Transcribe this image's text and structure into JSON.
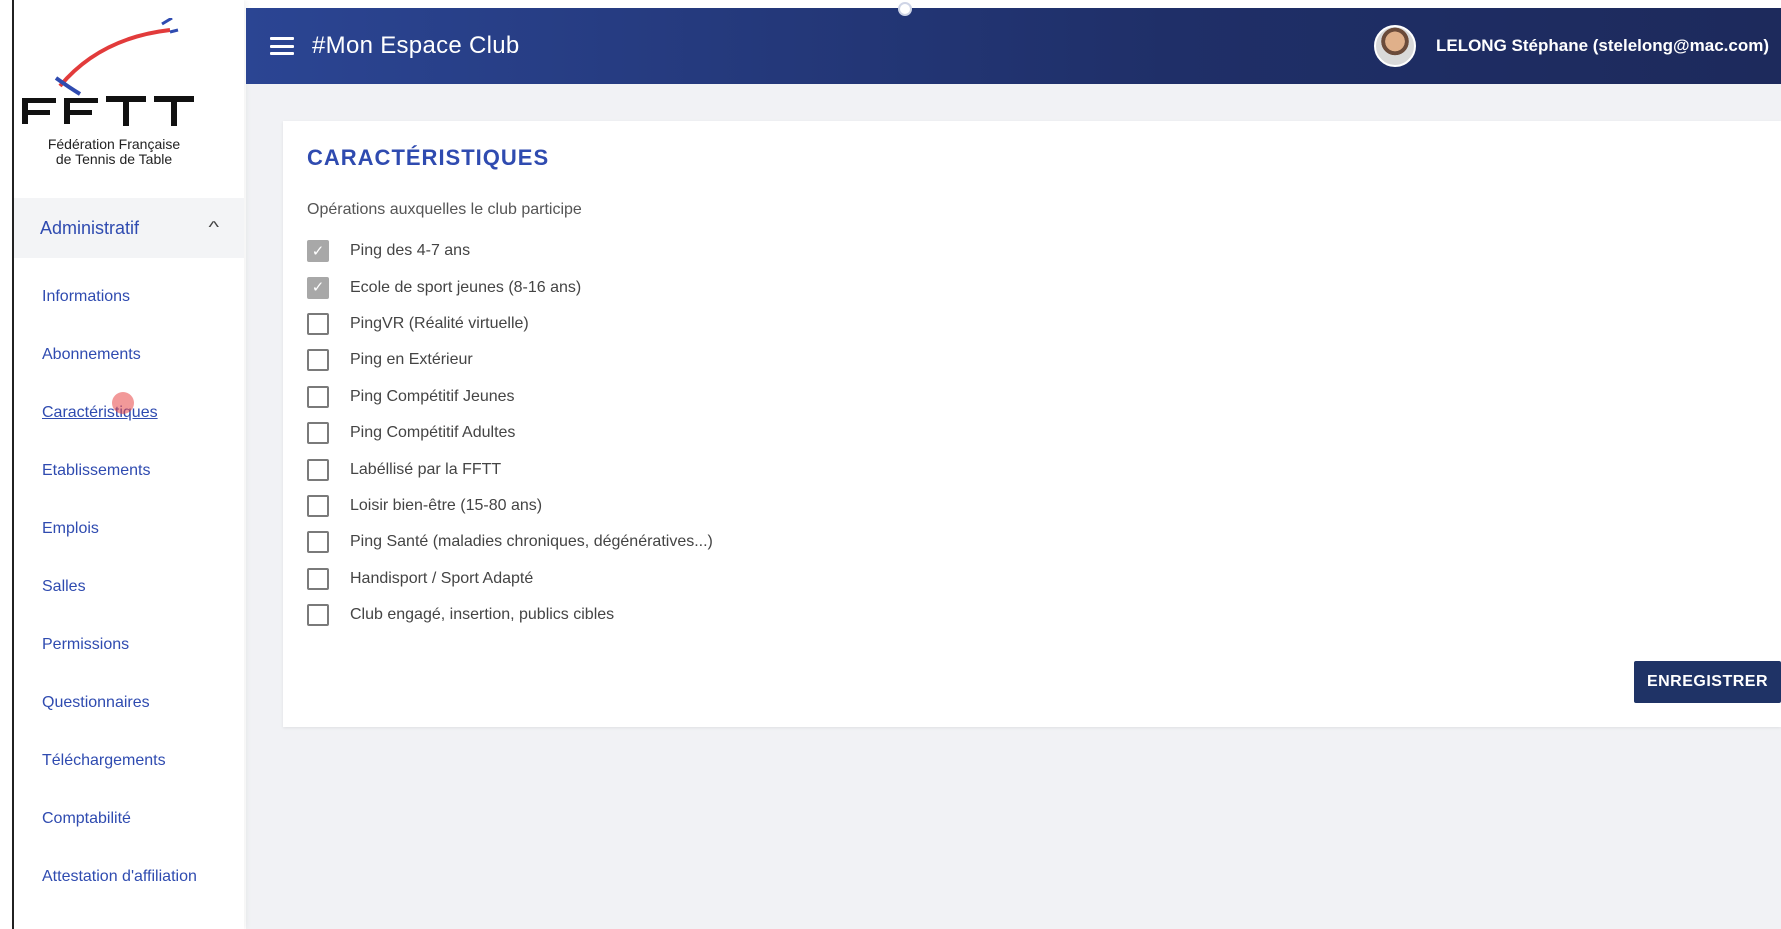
{
  "logo": {
    "line1": "Fédération Française",
    "line2": "de Tennis de Table"
  },
  "header": {
    "title": "#Mon Espace Club",
    "user": "LELONG Stéphane (stelelong@mac.com)"
  },
  "sidebar": {
    "section_label": "Administratif",
    "items": [
      {
        "label": "Informations"
      },
      {
        "label": "Abonnements"
      },
      {
        "label": "Caractéristiques"
      },
      {
        "label": "Etablissements"
      },
      {
        "label": "Emplois"
      },
      {
        "label": "Salles"
      },
      {
        "label": "Permissions"
      },
      {
        "label": "Questionnaires"
      },
      {
        "label": "Téléchargements"
      },
      {
        "label": "Comptabilité"
      },
      {
        "label": "Attestation d'affiliation"
      }
    ]
  },
  "card": {
    "title": "CARACTÉRISTIQUES",
    "subtitle": "Opérations auxquelles le club participe",
    "options": [
      {
        "label": "Ping des 4-7 ans",
        "checked": true
      },
      {
        "label": "Ecole de sport jeunes (8-16 ans)",
        "checked": true
      },
      {
        "label": "PingVR (Réalité virtuelle)",
        "checked": false
      },
      {
        "label": "Ping en Extérieur",
        "checked": false
      },
      {
        "label": "Ping Compétitif Jeunes",
        "checked": false
      },
      {
        "label": "Ping Compétitif Adultes",
        "checked": false
      },
      {
        "label": "Labéllisé par la FFTT",
        "checked": false
      },
      {
        "label": "Loisir bien-être (15-80 ans)",
        "checked": false
      },
      {
        "label": "Ping Santé (maladies chroniques, dégénératives...)",
        "checked": false
      },
      {
        "label": "Handisport / Sport Adapté",
        "checked": false
      },
      {
        "label": "Club engagé, insertion, publics cibles",
        "checked": false
      }
    ],
    "save_label": "ENREGISTRER"
  },
  "colors": {
    "brand_blue": "#2f4bb0",
    "header_dark": "#1f2f68",
    "button_navy": "#1f3366"
  }
}
